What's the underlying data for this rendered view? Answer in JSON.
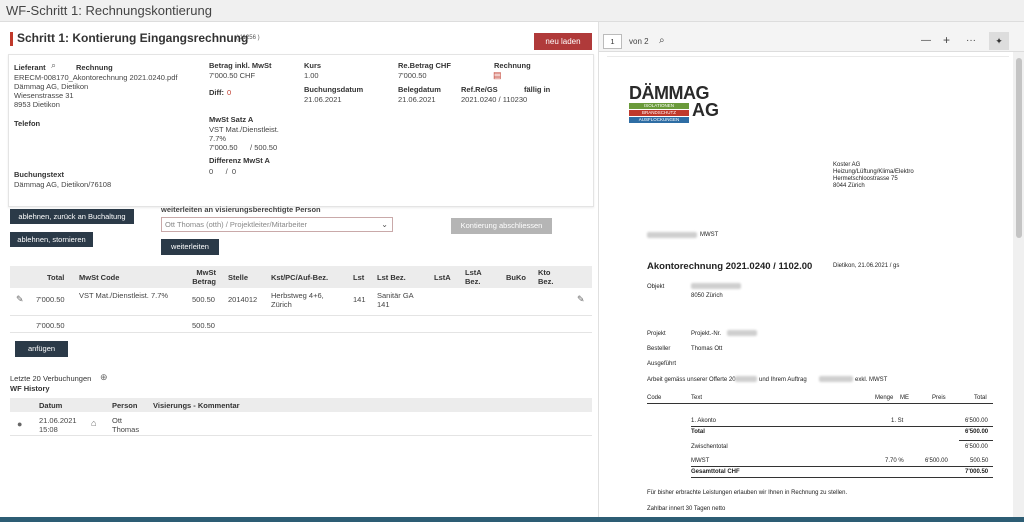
{
  "window": {
    "title": "WF-Schritt 1: Rechnungskontierung"
  },
  "header": {
    "title": "Schritt 1: Kontierung Eingangsrechnung",
    "id": "( 11256 )",
    "reload_button": "neu laden"
  },
  "info": {
    "lieferant_label": "Lieferant",
    "rechnung_label": "Rechnung",
    "filename": "ERECM-008170_Akontorechnung 2021.0240.pdf",
    "address": [
      "Dämmag AG, Dietikon",
      "Wiesenstrasse 31",
      "8953  Dietikon"
    ],
    "telefon_label": "Telefon",
    "buchungstext_label": "Buchungstext",
    "buchungstext": "Dämmag AG, Dietikon/76108",
    "betrag_label": "Betrag inkl. MwSt",
    "betrag": "7'000.50 CHF",
    "diff_label": "Diff:",
    "diff_value": "0",
    "mwst_satz_label": "MwSt Satz A",
    "mwst_satz_lines": [
      "VST Mat./Dienstleist.",
      "7.7%",
      "7'000.50      / 500.50"
    ],
    "diff_mwst_label": "Differenz MwSt A",
    "diff_mwst": "0      /  0",
    "kurs_label": "Kurs",
    "kurs": "1.00",
    "buchungsdatum_label": "Buchungsdatum",
    "buchungsdatum": "21.06.2021",
    "rebetrag_label": "Re.Betrag CHF",
    "rebetrag": "7'000.50",
    "belegdatum_label": "Belegdatum",
    "belegdatum": "21.06.2021",
    "rechnung2_label": "Rechnung",
    "refre_label": "Ref.Re/GS",
    "refre": "2021.0240 / 110230",
    "faellig_label": "fällig in"
  },
  "actions": {
    "reject_back": "ablehnen, zurück an Buchaltung",
    "reject_cancel": "ablehnen, stornieren",
    "forward_label": "weiterleiten an visierungsberechtigte Person",
    "forward_select": "Ott Thomas (otth) / Projektleiter/Mitarbeiter",
    "forward_button": "weiterleiten",
    "complete_button": "Kontierung abschliessen"
  },
  "table": {
    "headers": [
      "Total",
      "MwSt Code",
      "MwSt Betrag",
      "Stelle",
      "Kst/PC/Auf-Bez.",
      "Lst",
      "Lst Bez.",
      "LstA",
      "LstA Bez.",
      "BuKo",
      "Kto Bez."
    ],
    "row": {
      "total": "7'000.50",
      "mwst_code": "VST Mat./Dienstleist. 7.7%",
      "mwst_betrag": "500.50",
      "stelle": "2014012",
      "kst": "Herbstweg 4+6, Zürich",
      "lst": "141",
      "lst_bez": "Sanitär GA 141"
    },
    "sum": {
      "total": "7'000.50",
      "mwst_betrag": "500.50"
    },
    "add_button": "anfügen"
  },
  "history": {
    "last_bookings": "Letzte 20 Verbuchungen",
    "wf_history": "WF History",
    "headers": [
      "Datum",
      "Person",
      "Visierungs - Kommentar"
    ],
    "row": {
      "date": "21.06.2021 15:08",
      "person": "Ott Thomas"
    }
  },
  "viewer": {
    "page": "1",
    "of_pages": "von 2",
    "zoom_out": "—",
    "zoom_in": "+",
    "more": "···"
  },
  "doc": {
    "logo_top": "DÄMMAG",
    "logo_ag": "AG",
    "logo_bars": [
      "ISOLATIONEN",
      "BRANDSCHUTZ",
      "AUSFLOCKUNGEN"
    ],
    "recipient": [
      "Koster AG",
      "Heizung/Lüftung/Klima/Elektro",
      "Hermetschloostrasse 75",
      "8044 Zürich"
    ],
    "mwst_ref": "MWST",
    "title": "Akontorechnung 2021.0240 / 1102.00",
    "date": "Dietikon, 21.06.2021  / gs",
    "objekt_label": "Objekt",
    "objekt_city": "8050 Zürich",
    "projekt_label": "Projekt",
    "projekt_value": "Projekt.-Nr.",
    "besteller_label": "Besteller",
    "besteller_value": "Thomas Ott",
    "ausgefuehrt_label": "Ausgeführt",
    "arbeit_text_1": "Arbeit gemäss unserer Offerte 20",
    "arbeit_text_2": "und Ihrem Auftrag",
    "arbeit_text_3": "exkl. MWST",
    "cols": [
      "Code",
      "Text",
      "Menge",
      "ME",
      "Preis",
      "Total"
    ],
    "item_text": "1. Akonto",
    "item_menge": "1. St",
    "item_total": "6'500.00",
    "total_label": "Total",
    "total_value": "6'500.00",
    "zwischentotal_label": "Zwischentotal",
    "zwischentotal_value": "6'500.00",
    "mwst_label": "MWST",
    "mwst_rate": "7.70 %",
    "mwst_base": "6'500.00",
    "mwst_value": "500.50",
    "gesamt_label": "Gesamttotal CHF",
    "gesamt_value": "7'000.50",
    "footer1": "Für bisher erbrachte Leistungen erlauben wir Ihnen in Rechnung zu stellen.",
    "footer2": "Zahlbar innert 30 Tagen netto"
  }
}
